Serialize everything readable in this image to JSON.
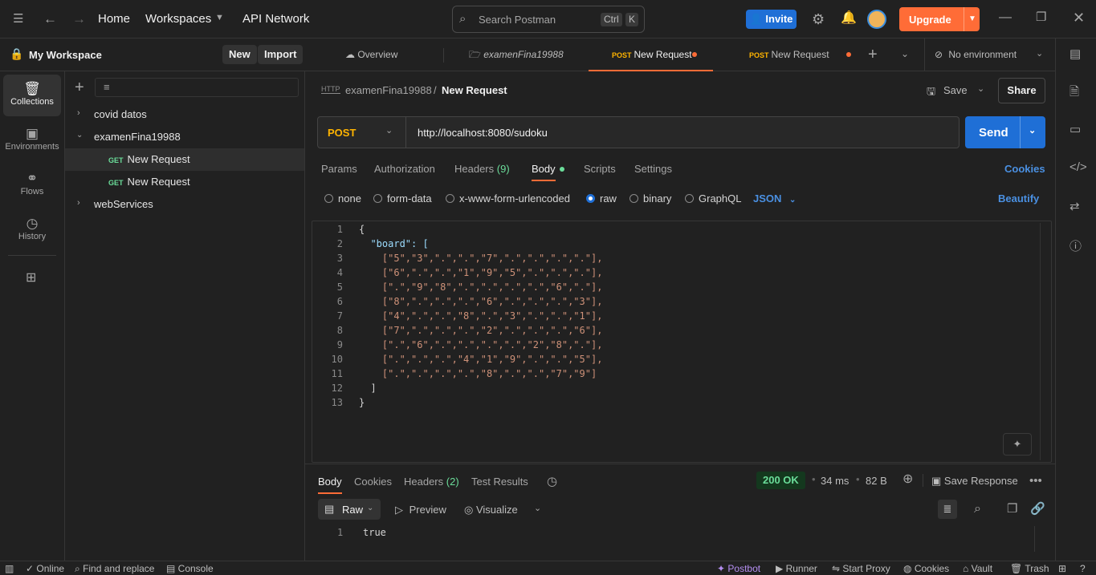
{
  "topbar": {
    "home": "Home",
    "workspaces": "Workspaces",
    "api_network": "API Network",
    "search_placeholder": "Search Postman",
    "kbd1": "Ctrl",
    "kbd2": "K",
    "invite": "Invite",
    "upgrade": "Upgrade"
  },
  "workspace": {
    "title": "My Workspace",
    "new": "New",
    "import": "Import"
  },
  "rail": [
    {
      "label": "Collections",
      "icon": "collections-icon"
    },
    {
      "label": "Environments",
      "icon": "environments-icon"
    },
    {
      "label": "Flows",
      "icon": "flows-icon"
    },
    {
      "label": "History",
      "icon": "history-icon"
    }
  ],
  "tree": {
    "c1": "covid datos",
    "c2": "examenFina19988",
    "r1_method": "GET",
    "r1": "New Request",
    "r2_method": "GET",
    "r2": "New Request",
    "c3": "webServices"
  },
  "tabs": {
    "overview": "Overview",
    "t2": "examenFina19988",
    "t3_method": "POST",
    "t3": "New Request",
    "t4_method": "POST",
    "t4": "New Request",
    "env": "No environment"
  },
  "request": {
    "breadcrumb_parent": "examenFina19988",
    "breadcrumb_sep": "/",
    "breadcrumb_name": "New Request",
    "save": "Save",
    "share": "Share",
    "method": "POST",
    "url": "http://localhost:8080/sudoku",
    "send": "Send"
  },
  "req_tabs": {
    "params": "Params",
    "authorization": "Authorization",
    "headers": "Headers",
    "headers_count": "(9)",
    "body": "Body",
    "scripts": "Scripts",
    "settings": "Settings",
    "cookies": "Cookies"
  },
  "body_modes": {
    "none": "none",
    "form_data": "form-data",
    "urlencoded": "x-www-form-urlencoded",
    "raw": "raw",
    "binary": "binary",
    "graphql": "GraphQL",
    "json": "JSON",
    "beautify": "Beautify"
  },
  "code_lines": [
    "{",
    "  \"board\": [",
    "    [\"5\",\"3\",\".\",\".\",\"7\",\".\",\".\",\".\",\".\"],",
    "    [\"6\",\".\",\".\",\"1\",\"9\",\"5\",\".\",\".\",\".\"],",
    "    [\".\",\"9\",\"8\",\".\",\".\",\".\",\".\",\"6\",\".\"],",
    "    [\"8\",\".\",\".\",\".\",\"6\",\".\",\".\",\".\",\"3\"],",
    "    [\"4\",\".\",\".\",\"8\",\".\",\"3\",\".\",\".\",\"1\"],",
    "    [\"7\",\".\",\".\",\".\",\"2\",\".\",\".\",\".\",\"6\"],",
    "    [\".\",\"6\",\".\",\".\",\".\",\".\",\"2\",\"8\",\".\"],",
    "    [\".\",\".\",\".\",\"4\",\"1\",\"9\",\".\",\".\",\"5\"],",
    "    [\".\",\".\",\".\",\".\",\"8\",\".\",\".\",\"7\",\"9\"]",
    "  ]",
    "}"
  ],
  "line_numbers": [
    "1",
    "2",
    "3",
    "4",
    "5",
    "6",
    "7",
    "8",
    "9",
    "10",
    "11",
    "12",
    "13"
  ],
  "response": {
    "body": "Body",
    "cookies": "Cookies",
    "headers": "Headers",
    "headers_count": "(2)",
    "tests": "Test Results",
    "status": "200 OK",
    "time": "34 ms",
    "size": "82 B",
    "save_response": "Save Response",
    "raw": "Raw",
    "preview": "Preview",
    "visualize": "Visualize",
    "line1_num": "1",
    "line1": "true"
  },
  "bottombar": {
    "online": "Online",
    "find": "Find and replace",
    "console": "Console",
    "postbot": "Postbot",
    "runner": "Runner",
    "proxy": "Start Proxy",
    "cookies": "Cookies",
    "vault": "Vault",
    "trash": "Trash"
  },
  "colors": {
    "accent_orange": "#ff6c37",
    "accent_blue": "#1f6fd6",
    "get_green": "#6bdd9a",
    "post_yellow": "#ffb400"
  }
}
